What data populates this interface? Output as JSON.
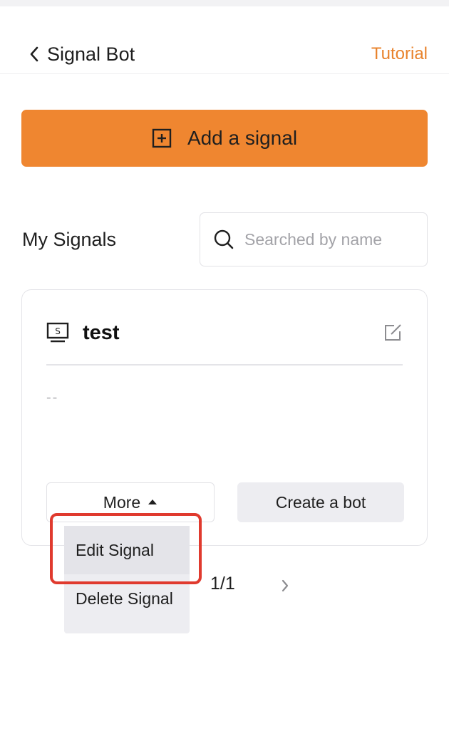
{
  "header": {
    "title": "Signal Bot",
    "tutorial_label": "Tutorial",
    "back_icon": "chevron-left-icon"
  },
  "add_signal": {
    "label": "Add a signal",
    "icon": "plus-square-icon"
  },
  "my_signals": {
    "title": "My Signals",
    "search": {
      "placeholder": "Searched by name",
      "value": "",
      "icon": "search-icon"
    }
  },
  "signal_card": {
    "name": "test",
    "description": "--",
    "icon": "signal-monitor-icon",
    "edit_icon": "edit-icon",
    "more_label": "More",
    "create_bot_label": "Create a bot"
  },
  "more_menu": {
    "items": [
      {
        "label": "Edit Signal"
      },
      {
        "label": "Delete Signal"
      }
    ]
  },
  "pagination": {
    "text": "1/1"
  },
  "colors": {
    "accent": "#ef8630",
    "link": "#e8822b",
    "highlight": "#e03a2e"
  }
}
